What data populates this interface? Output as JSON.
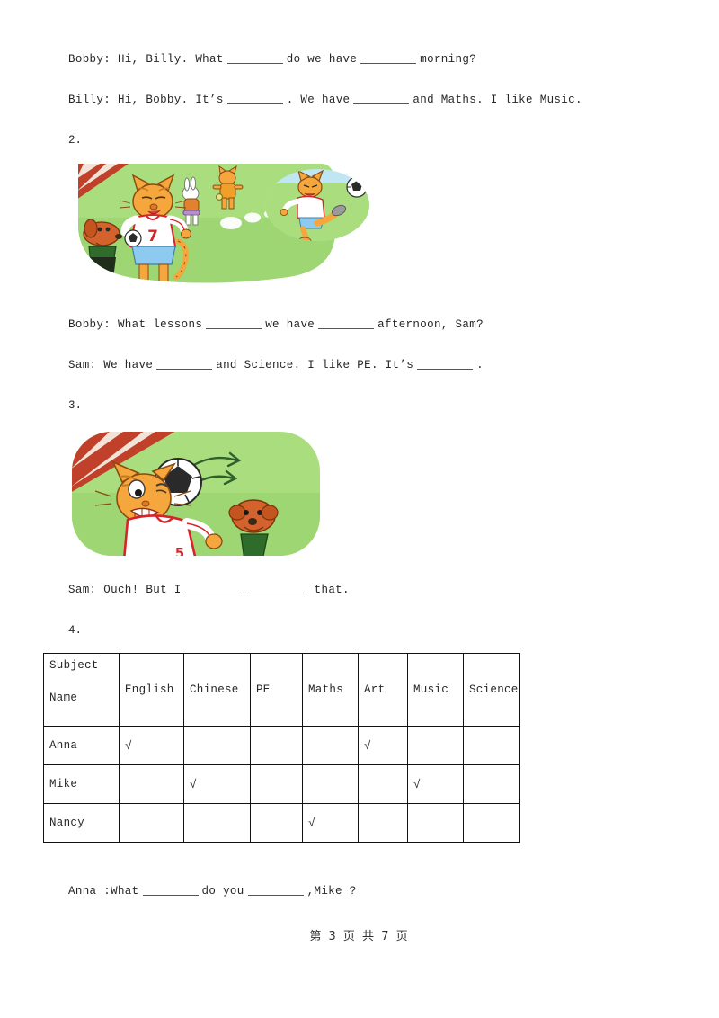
{
  "document": {
    "footer": "第 3 页 共 7 页",
    "page_number": "3",
    "total_pages": "7"
  },
  "exercises": [
    {
      "number": "",
      "lines": [
        {
          "before": "Bobby: Hi, Billy. What",
          "mid": "do we have",
          "after": "morning?",
          "blanks": 2
        },
        {
          "before": "Billy: Hi, Bobby. It’s",
          "mid": ". We have",
          "after": "and Maths. I like Music.",
          "blanks": 2
        }
      ]
    },
    {
      "number": "2.",
      "image": {
        "alt": "Cartoon cat in football kit number 7 on a green field with a dog, a rabbit and another cat, plus a thought bubble of the cat kicking a football",
        "colors": {
          "field": "#a9dd7e",
          "field_dark": "#8fcd63",
          "track": "#c0402a",
          "track_light": "#d9674c",
          "cat_fur": "#f5a63c",
          "cat_stripe": "#c87a22",
          "dog_fur": "#d4622c",
          "shirt": "#ffffff",
          "shirt_trim": "#d8232a",
          "shorts": "#8ec9ef",
          "bubble_sky": "#bfe6f2"
        }
      },
      "lines": [
        {
          "before": "Bobby:  What lessons",
          "mid": "we have",
          "after": "afternoon, Sam?",
          "blanks": 2
        },
        {
          "before": "Sam: We have",
          "mid": "and Science. I like PE. It’s",
          "after": ".",
          "blanks": 2
        }
      ]
    },
    {
      "number": "3.",
      "image": {
        "alt": "Cartoon cat hit in the head by a football while a small dog watches",
        "colors": {
          "field": "#a9dd7e",
          "track": "#c0402a",
          "cat_fur": "#f5a63c",
          "dog_fur": "#d4622c",
          "ball": "#ffffff"
        }
      },
      "lines": [
        {
          "before": "Sam: Ouch! But I",
          "mid": "",
          "after": "that.",
          "blanks": 2
        }
      ]
    },
    {
      "number": "4.",
      "lines": [
        {
          "before": "Anna :What",
          "mid": "do you",
          "after": ",Mike ?",
          "blanks": 2
        }
      ]
    }
  ],
  "table": {
    "corner_top": "Subject",
    "corner_bottom": "Name",
    "columns": [
      "English",
      "Chinese",
      "PE",
      "Maths",
      "Art",
      "Music",
      "Science"
    ],
    "tick_symbol": "√",
    "rows": [
      {
        "name": "Anna",
        "marks": [
          true,
          false,
          false,
          false,
          true,
          false,
          false
        ]
      },
      {
        "name": "Mike",
        "marks": [
          false,
          true,
          false,
          false,
          false,
          true,
          false
        ]
      },
      {
        "name": "Nancy",
        "marks": [
          false,
          false,
          false,
          true,
          false,
          false,
          false
        ]
      }
    ]
  }
}
